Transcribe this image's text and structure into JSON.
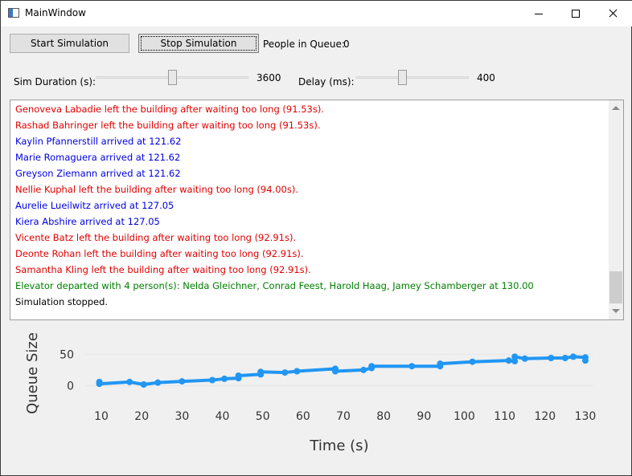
{
  "window": {
    "title": "MainWindow"
  },
  "controls": {
    "start_label": "Start Simulation",
    "stop_label": "Stop Simulation",
    "queue_label": "People in Queue:",
    "queue_value": "0",
    "duration_label": "Sim Duration (s):",
    "duration_value": "3600",
    "duration_fraction": 0.5,
    "delay_label": "Delay (ms):",
    "delay_value": "400",
    "delay_fraction": 0.4
  },
  "log": [
    {
      "text": "Genoveva Labadie left the building after waiting too long (91.53s).",
      "color": "red"
    },
    {
      "text": "Rashad Bahringer left the building after waiting too long (91.53s).",
      "color": "red"
    },
    {
      "text": "Kaylin Pfannerstill arrived at 121.62",
      "color": "blue"
    },
    {
      "text": "Marie Romaguera arrived at 121.62",
      "color": "blue"
    },
    {
      "text": "Greyson Ziemann arrived at 121.62",
      "color": "blue"
    },
    {
      "text": "Nellie Kuphal left the building after waiting too long (94.00s).",
      "color": "red"
    },
    {
      "text": "Aurelie Lueilwitz arrived at 127.05",
      "color": "blue"
    },
    {
      "text": "Kiera Abshire arrived at 127.05",
      "color": "blue"
    },
    {
      "text": "Vicente Batz left the building after waiting too long (92.91s).",
      "color": "red"
    },
    {
      "text": "Deonte Rohan left the building after waiting too long (92.91s).",
      "color": "red"
    },
    {
      "text": "Samantha Kling left the building after waiting too long (92.91s).",
      "color": "red"
    },
    {
      "text": "Elevator departed with 4 person(s): Nelda Gleichner, Conrad Feest, Harold Haag, Jamey Schamberger at 130.00",
      "color": "green"
    },
    {
      "text": "Simulation stopped.",
      "color": "black"
    }
  ],
  "colors": {
    "line": "#2196f3",
    "red": "#e00000",
    "blue": "#0000e0",
    "green": "#008000"
  },
  "chart_data": {
    "type": "line",
    "xlabel": "Time (s)",
    "ylabel": "Queue Size",
    "xticks": [
      10,
      20,
      30,
      40,
      50,
      60,
      70,
      80,
      90,
      100,
      110,
      120,
      130
    ],
    "yticks": [
      0,
      50
    ],
    "xlim": [
      6,
      132
    ],
    "ylim": [
      -12,
      58
    ],
    "grid": true,
    "series": [
      {
        "x": [
          9.5,
          9.5,
          17,
          20.5,
          24,
          30,
          37.5,
          40.5,
          44,
          44,
          49.5,
          49.5,
          55.5,
          58.5,
          68,
          68,
          75,
          77,
          77,
          87,
          94,
          94,
          102,
          111,
          112.5,
          112.5,
          115,
          121.5,
          125,
          127,
          130,
          130
        ],
        "y": [
          6,
          3,
          6,
          2,
          5,
          7,
          9,
          11,
          12,
          16,
          18,
          22,
          21,
          23,
          27,
          23,
          25,
          28,
          31,
          31,
          31,
          35,
          38,
          40,
          39,
          46,
          43,
          44,
          44,
          46,
          45,
          40
        ]
      }
    ]
  }
}
